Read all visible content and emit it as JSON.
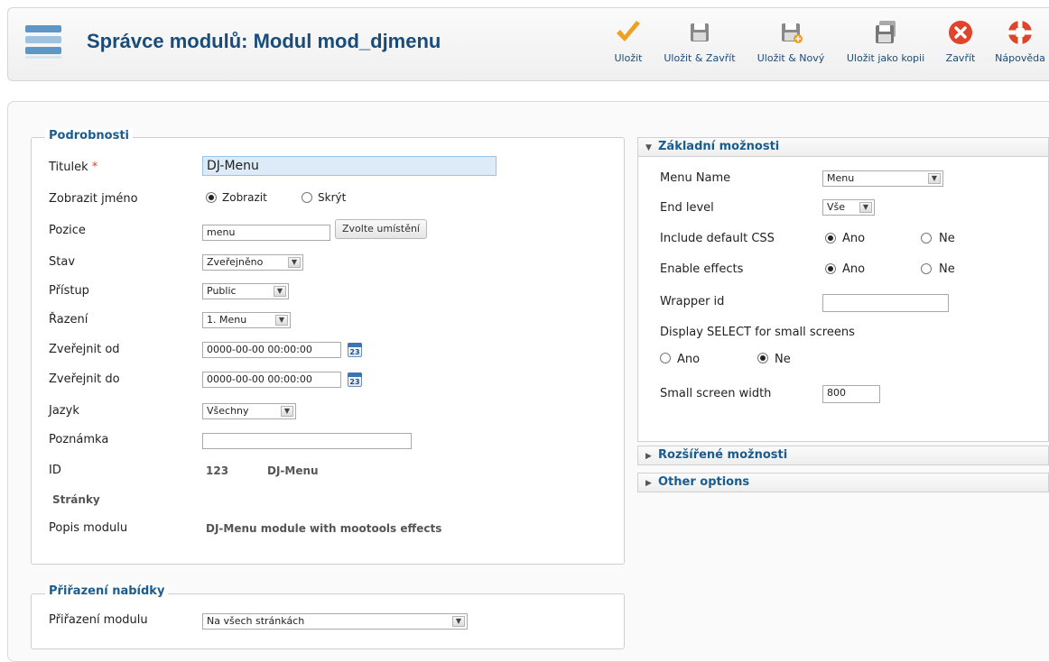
{
  "header": {
    "title": "Správce modulů: Modul mod_djmenu",
    "toolbar": [
      {
        "label": "Uložit",
        "icon": "checkmark-icon"
      },
      {
        "label": "Uložit & Zavřít",
        "icon": "save-close-icon"
      },
      {
        "label": "Uložit & Nový",
        "icon": "save-new-icon"
      },
      {
        "label": "Uložit jako kopii",
        "icon": "save-copy-icon"
      },
      {
        "label": "Zavřít",
        "icon": "close-icon"
      },
      {
        "label": "Nápověda",
        "icon": "help-icon"
      }
    ]
  },
  "details": {
    "legend": "Podrobnosti",
    "title_label": "Titulek",
    "required_mark": "*",
    "title_value": "DJ-Menu",
    "show_name_label": "Zobrazit jméno",
    "show_option": "Zobrazit",
    "hide_option": "Skrýt",
    "position_label": "Pozice",
    "position_value": "menu",
    "choose_position_button": "Zvolte umístění",
    "status_label": "Stav",
    "status_value": "Zveřejněno",
    "access_label": "Přístup",
    "access_value": "Public",
    "ordering_label": "Řazení",
    "ordering_value": "1. Menu",
    "publish_up_label": "Zveřejnit od",
    "publish_up_value": "0000-00-00 00:00:00",
    "publish_down_label": "Zveřejnit do",
    "publish_down_value": "0000-00-00 00:00:00",
    "calendar_day": "23",
    "language_label": "Jazyk",
    "language_value": "Všechny",
    "note_label": "Poznámka",
    "note_value": "",
    "id_label": "ID",
    "id_value": "123",
    "module_name": "DJ-Menu",
    "pages_label": "Stránky",
    "description_label": "Popis modulu",
    "description_value": "DJ-Menu module with mootools effects"
  },
  "menu_assignment": {
    "legend": "Přiřazení nabídky",
    "module_assignment_label": "Přiřazení modulu",
    "module_assignment_value": "Na všech stránkách"
  },
  "basic_options": {
    "header": "Základní možnosti",
    "menu_name_label": "Menu Name",
    "menu_name_value": "Menu",
    "end_level_label": "End level",
    "end_level_value": "Vše",
    "include_css_label": "Include default CSS",
    "enable_effects_label": "Enable effects",
    "yes": "Ano",
    "no": "Ne",
    "wrapper_id_label": "Wrapper id",
    "wrapper_id_value": "",
    "display_select_label": "Display SELECT for small screens",
    "small_screen_width_label": "Small screen width",
    "small_screen_width_value": "800"
  },
  "advanced_options": {
    "header": "Rozšířené možnosti"
  },
  "other_options": {
    "header": "Other options"
  },
  "colors": {
    "heading_blue": "#1a5c8f",
    "title_blue": "#1a4c7a",
    "accent_orange": "#f0a020",
    "close_red": "#e0442c"
  }
}
